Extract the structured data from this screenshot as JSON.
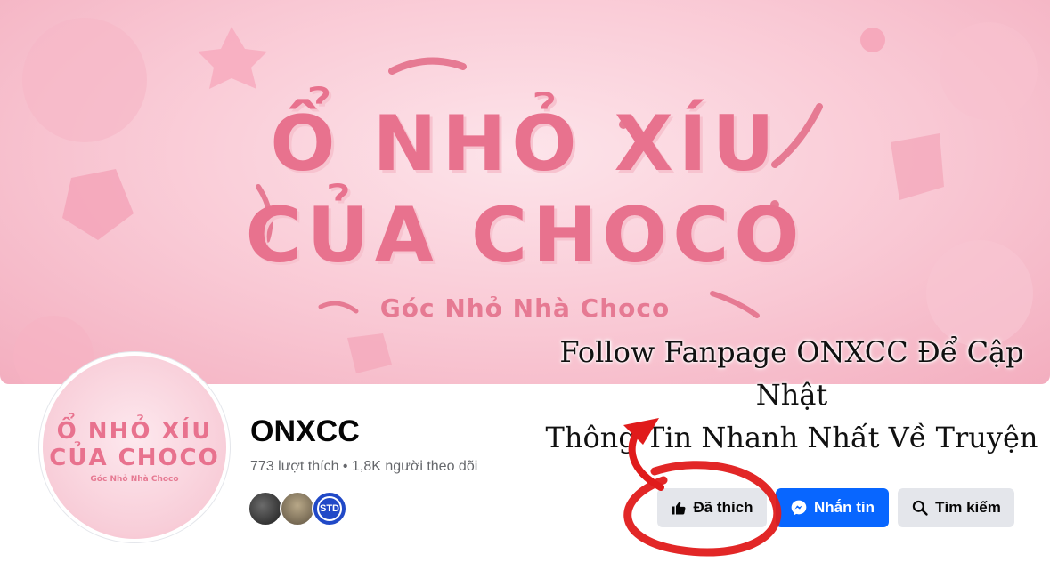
{
  "cover": {
    "title_line1": "Ổ NHỎ XÍU",
    "title_line2": "CỦA CHOCO",
    "subtitle": "Góc Nhỏ Nhà Choco"
  },
  "overlay_caption": {
    "line1": "Follow Fanpage ONXCC Để Cập Nhật",
    "line2": "Thông Tin Nhanh Nhất Về Truyện"
  },
  "avatar": {
    "line1": "Ổ NHỎ XÍU",
    "line2": "CỦA CHOCO",
    "line3": "Góc Nhỏ Nhà Choco"
  },
  "page": {
    "name": "ONXCC",
    "stats": "773 lượt thích • 1,8K người theo dõi"
  },
  "followers": [
    {
      "icon": "follower-avatar-dark"
    },
    {
      "icon": "follower-avatar-beige"
    },
    {
      "icon": "follower-avatar-logo",
      "label": "STD"
    }
  ],
  "actions": {
    "like_label": "Đã thích",
    "message_label": "Nhắn tin",
    "search_label": "Tìm kiếm"
  },
  "colors": {
    "primary_blue": "#0866ff",
    "secondary_button": "#e4e6eb",
    "annotation_red": "#e01b1b",
    "cover_pink": "#e8728e"
  }
}
